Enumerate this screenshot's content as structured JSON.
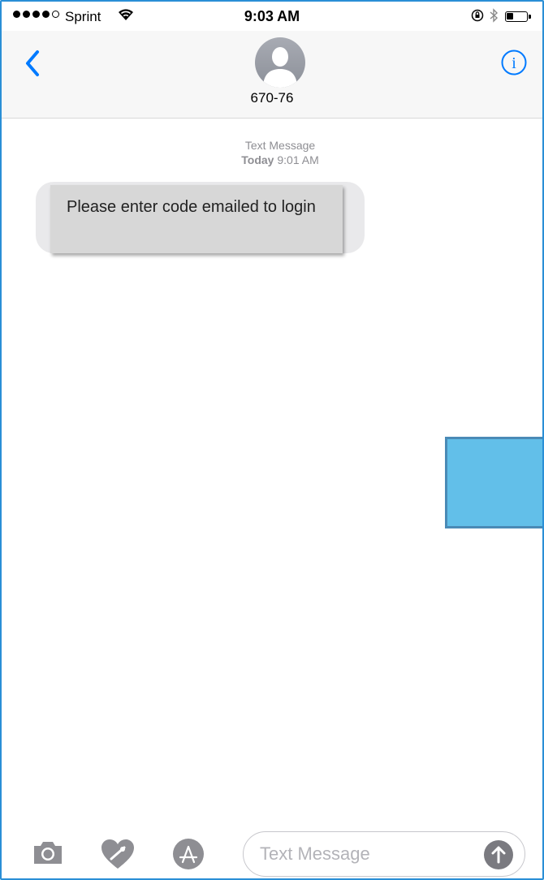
{
  "status_bar": {
    "carrier": "Sprint",
    "time": "9:03 AM",
    "battery_fraction": 0.35
  },
  "nav": {
    "contact_name": "670-76",
    "back_icon": "chevron-left-icon",
    "info_icon": "info-icon",
    "accent_color": "#007aff"
  },
  "thread": {
    "service_label": "Text Message",
    "day_label": "Today",
    "time_label": "9:01 AM",
    "messages": [
      {
        "direction": "incoming",
        "text": "Please enter code emailed to login"
      }
    ]
  },
  "input_bar": {
    "placeholder": "Text Message",
    "value": "",
    "buttons": [
      "camera-icon",
      "digital-touch-heart-icon",
      "app-store-icon",
      "send-arrow-icon"
    ]
  },
  "overlay_color": "#62bfe9"
}
